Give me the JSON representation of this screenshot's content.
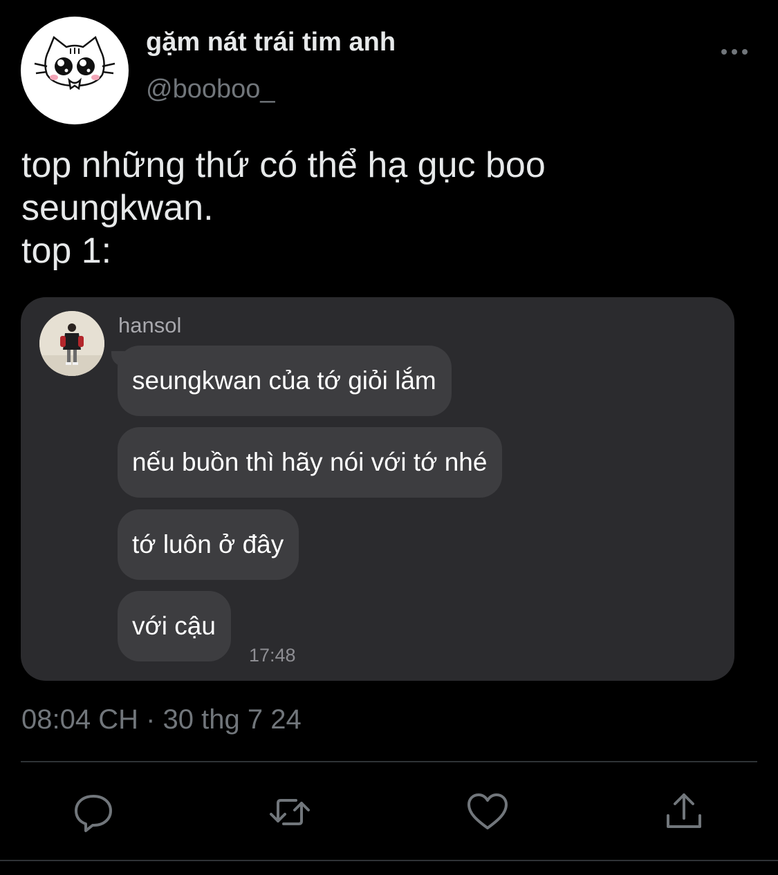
{
  "author": {
    "display_name": "gặm nát trái tim anh",
    "handle": "@booboo_",
    "avatar_icon": "cat-face-avatar-icon"
  },
  "tweet": {
    "lines": [
      "top những thứ có thể hạ gục boo",
      "seungkwan.",
      "top 1:"
    ]
  },
  "chat": {
    "sender": "hansol",
    "messages": [
      "seungkwan của tớ giỏi lắm",
      "nếu buồn thì hãy nói với tớ nhé",
      "tớ luôn ở đây",
      "với cậu"
    ],
    "time": "17:48"
  },
  "timestamp": "08:04 CH · 30 thg 7 24",
  "actions": [
    "reply-icon",
    "retweet-icon",
    "like-icon",
    "share-icon"
  ],
  "colors": {
    "background": "#000000",
    "text": "#e7e9ea",
    "secondary": "#71767b",
    "card": "#2b2b2e",
    "bubble": "#3d3d40"
  }
}
